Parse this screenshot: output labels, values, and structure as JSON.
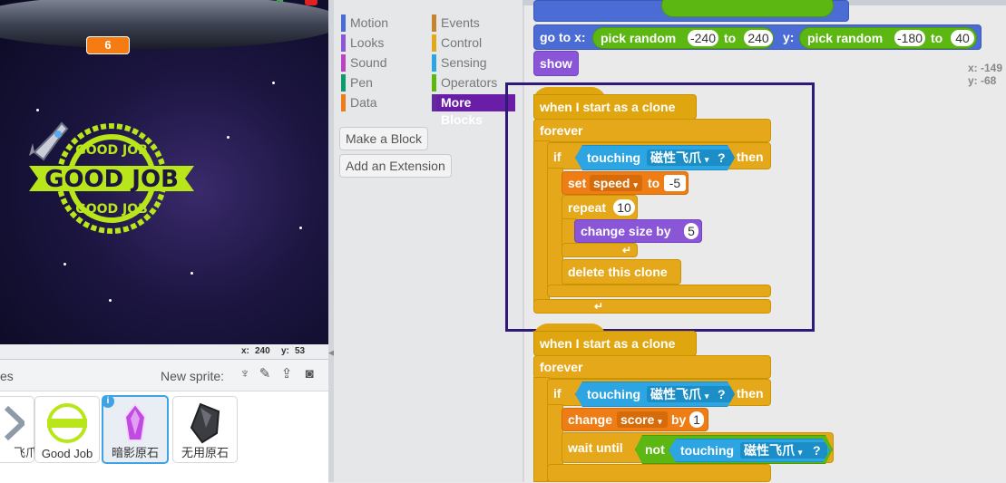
{
  "stage": {
    "score": "6",
    "coords": {
      "x_label": "x:",
      "x_value": "240",
      "y_label": "y:",
      "y_value": "53"
    }
  },
  "sprites": {
    "header_label": "es",
    "new_sprite_label": "New sprite:",
    "tiles": [
      {
        "name": "飞爪"
      },
      {
        "name": "Good Job"
      },
      {
        "name": "暗影原石"
      },
      {
        "name": "无用原石"
      }
    ]
  },
  "palette": {
    "categories_left": [
      "Motion",
      "Looks",
      "Sound",
      "Pen",
      "Data"
    ],
    "categories_right": [
      "Events",
      "Control",
      "Sensing",
      "Operators",
      "More Blocks"
    ],
    "category_colors": {
      "Motion": "#4a6cd4",
      "Looks": "#8a55d7",
      "Sound": "#bb42c3",
      "Pen": "#0e9a6c",
      "Data": "#ee7d16",
      "Events": "#c88330",
      "Control": "#e1a91a",
      "Sensing": "#2ca5e2",
      "Operators": "#5cb712",
      "More Blocks": "#632d99"
    },
    "make_block": "Make a Block",
    "add_extension": "Add an Extension"
  },
  "scripts": {
    "top": {
      "goto_label": "go to x:",
      "pick_random_1": "pick random",
      "v1": "-240",
      "to1": "to",
      "v2": "240",
      "y_label": "y:",
      "pick_random_2": "pick random",
      "v3": "-180",
      "to2": "to",
      "v4": "40",
      "show": "show"
    },
    "clone1": {
      "hat": "when I start as a clone",
      "forever": "forever",
      "if": "if",
      "touching": "touching",
      "touching_target": "磁性飞爪",
      "q": "?",
      "then": "then",
      "set": "set",
      "var": "speed",
      "to": "to",
      "set_value": "-5",
      "repeat": "repeat",
      "repeat_n": "10",
      "change_size": "change size by",
      "size_value": "5",
      "delete_clone": "delete this clone"
    },
    "clone2": {
      "hat": "when I start as a clone",
      "forever": "forever",
      "if": "if",
      "touching": "touching",
      "touching_target": "磁性飞爪",
      "q": "?",
      "then": "then",
      "change": "change",
      "var": "score",
      "by": "by",
      "value": "1",
      "wait_until": "wait until",
      "not": "not",
      "touching2": "touching",
      "touching_target2": "磁性飞爪",
      "q2": "?"
    },
    "mouse": {
      "x": "x: -149",
      "y": "y: -68"
    }
  }
}
